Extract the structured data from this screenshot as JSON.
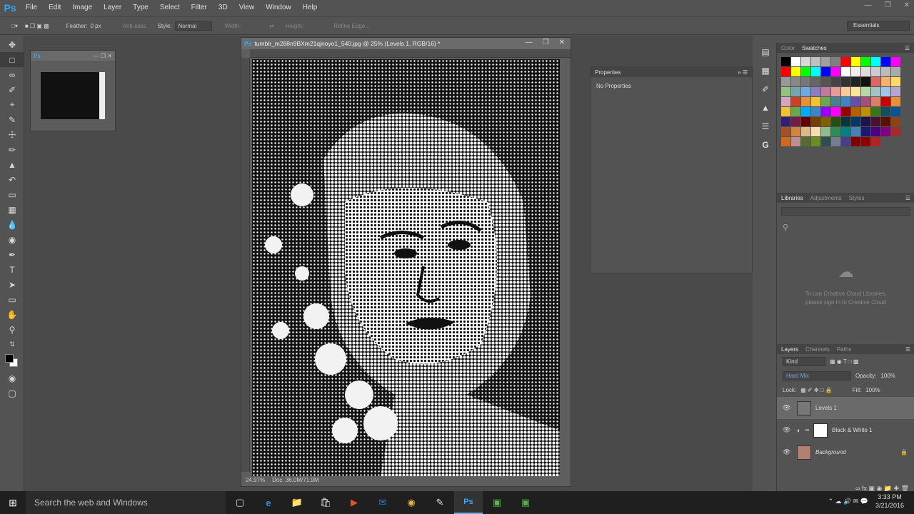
{
  "app": {
    "logo": "Ps"
  },
  "menu": [
    "File",
    "Edit",
    "Image",
    "Layer",
    "Type",
    "Select",
    "Filter",
    "3D",
    "View",
    "Window",
    "Help"
  ],
  "options": {
    "feather_label": "Feather:",
    "feather_value": "0 px",
    "antialias": "Anti-alias",
    "style_label": "Style:",
    "style_value": "Normal",
    "width_label": "Width:",
    "height_label": "Height:",
    "refine": "Refine Edge...",
    "workspace": "Essentials"
  },
  "document": {
    "title": "tumblr_m288n9BXm21qjnoyo1_540.jpg @ 25% (Levels 1, RGB/16) *",
    "zoom": "24.97%",
    "doc_info": "Doc: 36.0M/71.9M"
  },
  "properties": {
    "title": "Properties",
    "empty": "No Properties"
  },
  "color_panel": {
    "tabs": [
      "Color",
      "Swatches"
    ],
    "active": "Swatches",
    "swatches": [
      "#000000",
      "#ffffff",
      "#d8d8d8",
      "#c0c0c0",
      "#a0a0a0",
      "#808080",
      "#ff0000",
      "#ffff00",
      "#00ff00",
      "#00ffff",
      "#0000ff",
      "#ff00ff",
      "#ff0000",
      "#ffff00",
      "#00ff00",
      "#00ffff",
      "#0000ff",
      "#ff00ff",
      "#ffffff",
      "#eeeeee",
      "#dddddd",
      "#cccccc",
      "#bbbbbb",
      "#aaaaaa",
      "#999999",
      "#888888",
      "#777777",
      "#666666",
      "#555555",
      "#444444",
      "#333333",
      "#222222",
      "#111111",
      "#e06666",
      "#f6b26b",
      "#ffd966",
      "#93c47d",
      "#76a5af",
      "#6fa8dc",
      "#8e7cc3",
      "#c27ba0",
      "#ea9999",
      "#f9cb9c",
      "#ffe599",
      "#b6d7a8",
      "#a2c4c9",
      "#9fc5e8",
      "#b4a7d6",
      "#d5a6bd",
      "#cc4125",
      "#e69138",
      "#f1c232",
      "#6aa84f",
      "#45818e",
      "#3d85c6",
      "#674ea7",
      "#a64d79",
      "#dd7e6b",
      "#cc0000",
      "#e69138",
      "#f1c232",
      "#6aa84f",
      "#00aaff",
      "#3d85c6",
      "#9900ff",
      "#ff00ff",
      "#990000",
      "#b45f06",
      "#bf9000",
      "#38761d",
      "#134f5c",
      "#0b5394",
      "#351c75",
      "#741b47",
      "#660000",
      "#783f04",
      "#7f6000",
      "#274e13",
      "#0c343d",
      "#073763",
      "#20124d",
      "#4c1130",
      "#5b0f00",
      "#8b4513",
      "#a0522d",
      "#cd853f",
      "#deb887",
      "#f5deb3",
      "#8fbc8f",
      "#2e8b57",
      "#008080",
      "#4682b4",
      "#191970",
      "#4b0082",
      "#800080",
      "#a52a2a",
      "#d2691e",
      "#bc8f8f",
      "#556b2f",
      "#6b8e23",
      "#2f4f4f",
      "#708090",
      "#483d8b",
      "#800000",
      "#8b0000",
      "#b22222"
    ]
  },
  "libraries": {
    "tabs": [
      "Libraries",
      "Adjustments",
      "Styles"
    ],
    "active": "Libraries",
    "message_1": "To use Creative Cloud Libraries,",
    "message_2": "please sign in to Creative Cloud"
  },
  "layers_panel": {
    "tabs": [
      "Layers",
      "Channels",
      "Paths"
    ],
    "active": "Layers",
    "filter": "Kind",
    "blend_mode": "Hard Mix",
    "opacity_label": "Opacity:",
    "opacity": "100%",
    "lock_label": "Lock:",
    "fill_label": "Fill:",
    "fill": "100%",
    "layers": [
      {
        "name": "Levels 1",
        "selected": true
      },
      {
        "name": "Black & White 1",
        "selected": false
      },
      {
        "name": "Background",
        "selected": false
      }
    ]
  },
  "taskbar": {
    "search": "Search the web and Windows",
    "time": "3:33 PM",
    "date": "3/21/2016"
  }
}
